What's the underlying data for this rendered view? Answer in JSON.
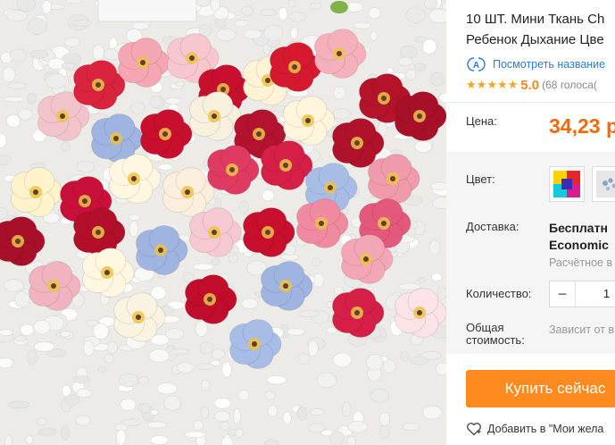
{
  "product": {
    "title_line1": "10 ШТ. Мини Ткань Ch",
    "title_line2": "Ребенок Дыхание Цве",
    "translate_link": "Посмотреть название",
    "rating": {
      "stars": 5,
      "score": "5.0",
      "votes": "(68 голоса("
    }
  },
  "price": {
    "label": "Цена:",
    "value": "34,23 р"
  },
  "color": {
    "label": "Цвет:"
  },
  "delivery": {
    "label": "Доставка:",
    "method_line1": "Бесплатн",
    "method_line2": "Economic",
    "estimate": "Расчётное в"
  },
  "quantity": {
    "label": "Количество:",
    "minus": "−",
    "value": "1"
  },
  "total": {
    "label_line1": "Общая",
    "label_line2": "стоимость:",
    "value": "Зависит от вы"
  },
  "actions": {
    "buy_label": "Купить сейчас",
    "wishlist_label": "Добавить в \"Мои жела"
  },
  "colors": {
    "accent": "#ff8a1f",
    "price": "#f06a0a",
    "link": "#2e7bd3",
    "star": "#f5a623"
  },
  "icons": [
    "translate-icon",
    "star-icon",
    "minus-icon",
    "heart-icon"
  ]
}
